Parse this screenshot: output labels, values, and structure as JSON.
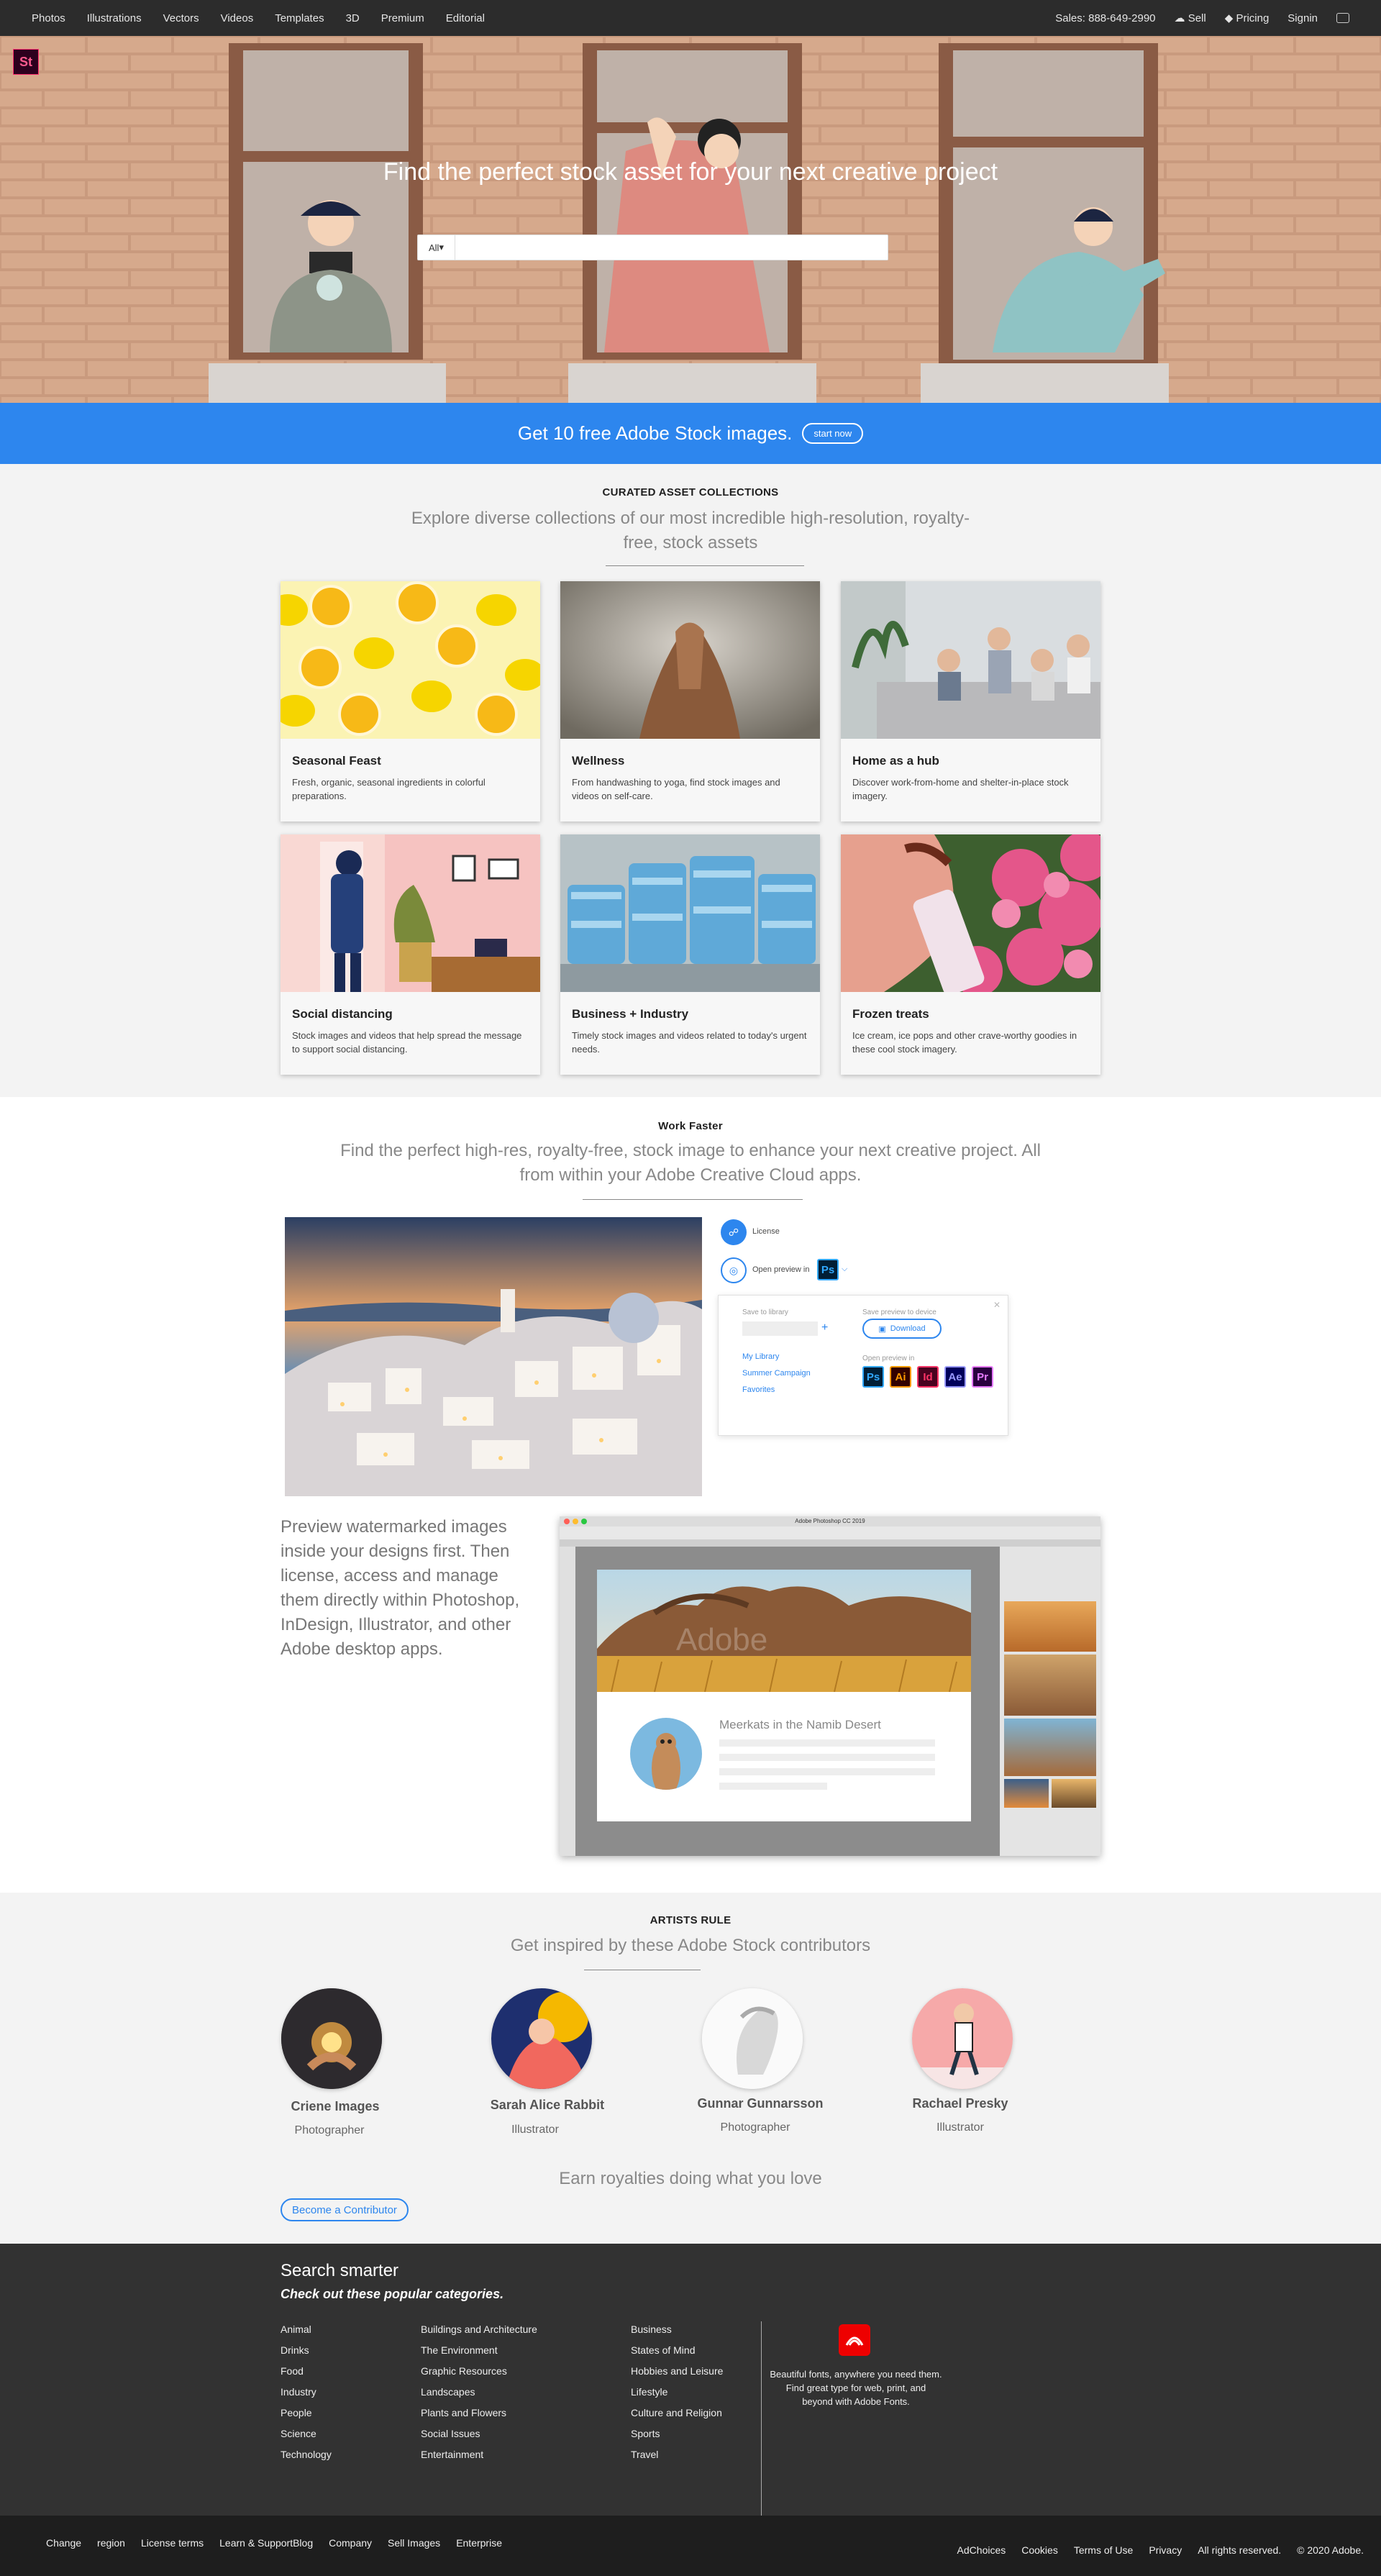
{
  "nav": {
    "left": [
      "Photos",
      "Illustrations",
      "Vectors",
      "Videos",
      "Templates",
      "3D",
      "Premium",
      "Editorial"
    ],
    "sales": "Sales: 888-649-2990",
    "sell": "Sell",
    "pricing": "Pricing",
    "signin": "Signin"
  },
  "hero": {
    "logo": "St",
    "title": "Find the perfect stock asset for your next creative project",
    "search_filter": "All",
    "search_placeholder": ""
  },
  "promo": {
    "text": "Get 10 free Adobe Stock images.",
    "button": "start now"
  },
  "curated": {
    "kicker": "CURATED ASSET COLLECTIONS",
    "lead": "Explore diverse collections of our most incredible high-resolution, royalty-free, stock assets",
    "cards": [
      {
        "title": "Seasonal Feast",
        "desc": "Fresh, organic, seasonal ingredients in colorful preparations."
      },
      {
        "title": "Wellness",
        "desc": "From handwashing to yoga, find stock images and videos on self-care."
      },
      {
        "title": "Home as a hub",
        "desc": "Discover work-from-home and shelter-in-place stock imagery."
      },
      {
        "title": "Social distancing",
        "desc": "Stock images and videos that help spread the message to support social distancing."
      },
      {
        "title": "Business + Industry",
        "desc": "Timely stock images and videos related to today's urgent needs."
      },
      {
        "title": "Frozen treats",
        "desc": "Ice cream, ice pops and other crave-worthy goodies in these cool stock imagery."
      }
    ]
  },
  "work": {
    "kicker": "Work Faster",
    "lead": "Find the perfect high-res, royalty-free, stock image to enhance your next creative project. All from within your Adobe Creative Cloud apps.",
    "panel": {
      "license": "License",
      "open_preview": "Open preview in",
      "ps": "Ps",
      "save_to_library": "Save to library",
      "save_preview": "Save preview to device",
      "download": "Download",
      "open_preview_in": "Open preview in",
      "libraries": [
        "My Library",
        "Summer Campaign",
        "Favorites"
      ],
      "apps": [
        "Ps",
        "Ai",
        "Id",
        "Ae",
        "Pr"
      ]
    },
    "body": "Preview watermarked images inside your designs first. Then license, access and manage them directly within Photoshop, InDesign, Illustrator, and other Adobe desktop apps.",
    "ps_window_title": "Adobe Photoshop CC 2019",
    "ps_caption": "Meerkats in the Namib Desert"
  },
  "artists": {
    "kicker": "ARTISTS RULE",
    "lead": "Get inspired by these Adobe Stock contributors",
    "list": [
      {
        "name": "Criene Images",
        "role": "Photographer"
      },
      {
        "name": "Sarah Alice Rabbit",
        "role": "Illustrator"
      },
      {
        "name": "Gunnar Gunnarsson",
        "role": "Photographer"
      },
      {
        "name": "Rachael Presky",
        "role": "Illustrator"
      }
    ],
    "earn": "Earn royalties doing what you love",
    "button": "Become a Contributor"
  },
  "footer": {
    "heading": "Search smarter",
    "sub": "Check out these popular categories.",
    "col1": [
      "Animal",
      "Drinks",
      "Food",
      "Industry",
      "People",
      "Science",
      "Technology"
    ],
    "col2": [
      "Buildings and Architecture",
      "The Environment",
      "Graphic Resources",
      "Landscapes",
      "Plants and Flowers",
      "Social Issues",
      "Entertainment"
    ],
    "col3": [
      "Business",
      "States of Mind",
      "Hobbies and Leisure",
      "Lifestyle",
      "Culture and Religion",
      "Sports",
      "Travel"
    ],
    "fonts_text": "Beautiful fonts, anywhere you need them. Find great type for web, print, and beyond with Adobe Fonts."
  },
  "legal": {
    "left": [
      "Change",
      "region",
      "License terms",
      "Learn & SupportBlog",
      "Company",
      "Sell Images",
      "Enterprise"
    ],
    "right": [
      "AdChoices",
      "Cookies",
      "Terms of Use",
      "Privacy",
      "All rights reserved.",
      "© 2020 Adobe."
    ]
  }
}
